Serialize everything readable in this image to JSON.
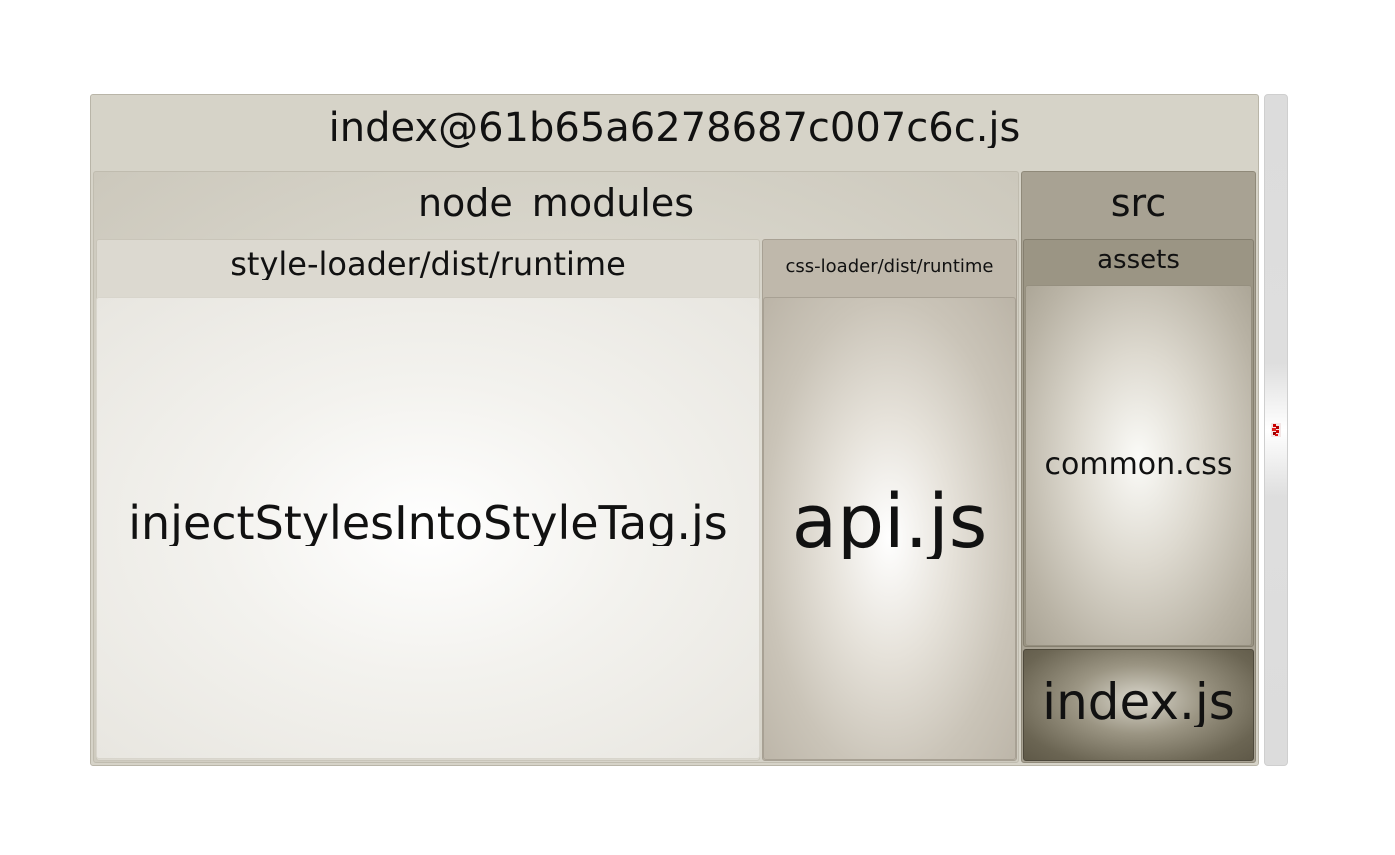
{
  "treemap": {
    "bundle": "index@61b65a6278687c007c6c.js",
    "node_modules": {
      "label": "node_modules",
      "style_loader": {
        "label": "style-loader/dist/runtime",
        "file": "injectStylesIntoStyleTag.js"
      },
      "css_loader": {
        "label": "css-loader/dist/runtime",
        "file": "api.js"
      }
    },
    "src": {
      "label": "src",
      "assets": {
        "label": "assets",
        "file": "common.css"
      },
      "file": "index.js"
    }
  },
  "sidebar": {
    "toggle_icon": "pin-icon",
    "accent_color": "#cc0000"
  },
  "colors": {
    "bundle": "#d6d3c8",
    "node_modules": "#d4d1c6",
    "style_loader": "#dcd9d0",
    "inject_file": "#ffffff",
    "css_loader": "#bfb8ab",
    "src": "#a8a293",
    "assets": "#9b9584",
    "index_file": "#5f5948"
  }
}
